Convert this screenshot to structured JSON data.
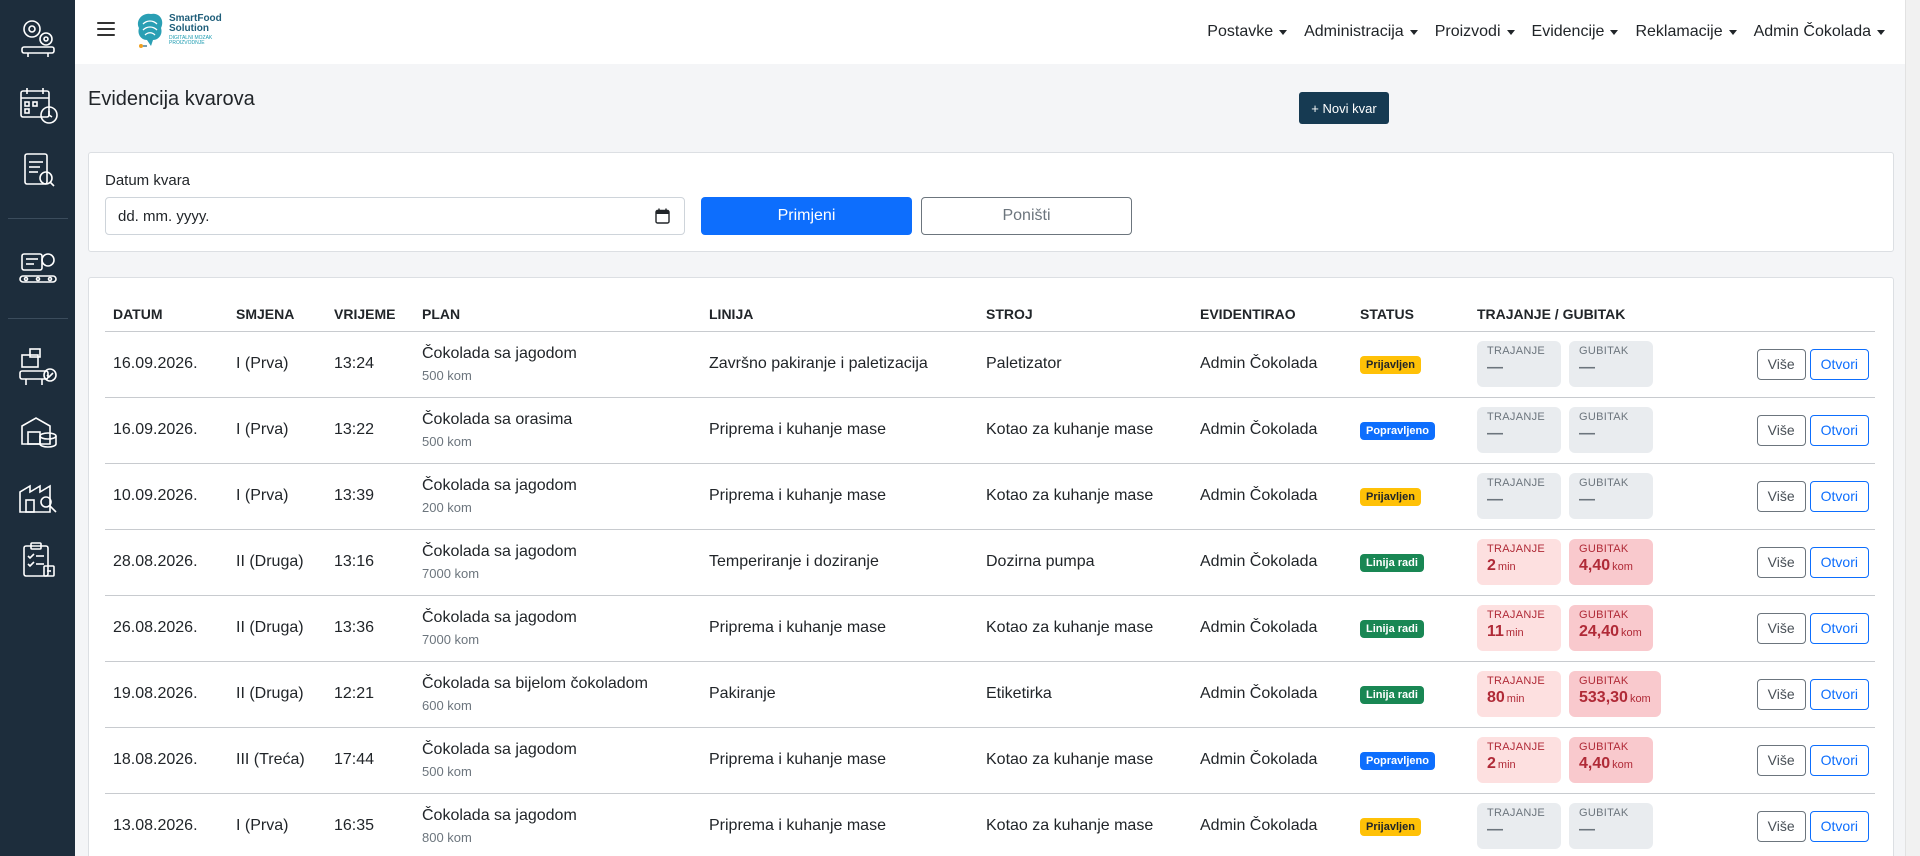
{
  "brand": {
    "name_line1": "SmartFood",
    "name_line2": "Solution",
    "tagline": "DIGITALNI MOZAK PROIZVODNJE"
  },
  "nav": {
    "items": [
      "Postavke",
      "Administracija",
      "Proizvodi",
      "Evidencije",
      "Reklamacije",
      "Admin Čokolada"
    ]
  },
  "sidebar": {
    "icons": [
      "factory-gears-icon",
      "calendar-schedule-icon",
      "report-analytics-icon",
      "production-line-icon",
      "delivery-tracking-icon",
      "warehouse-storage-icon",
      "machine-maintenance-icon",
      "checklist-clipboard-icon"
    ]
  },
  "page": {
    "title": "Evidencija kvarova",
    "new_button": "+ Novi kvar"
  },
  "filter": {
    "label": "Datum kvara",
    "date_placeholder": "dd. mm. yyyy.",
    "apply_label": "Primjeni",
    "reset_label": "Poništi"
  },
  "table": {
    "headers": [
      "Datum",
      "Smjena",
      "Vrijeme",
      "Plan",
      "Linija",
      "Stroj",
      "Evidentirao",
      "Status",
      "Trajanje / Gubitak"
    ],
    "metric_labels": {
      "duration": "TRAJANJE",
      "loss": "GUBITAK"
    },
    "empty_value": "—",
    "action_more": "Više",
    "action_open": "Otvori",
    "rows": [
      {
        "date": "16.09.2026.",
        "shift": "I (Prva)",
        "time": "13:24",
        "plan": "Čokolada sa jagodom",
        "qty": "500 kom",
        "line": "Završno pakiranje i paletizacija",
        "machine": "Paletizator",
        "by": "Admin Čokolada",
        "status": "Prijavljen",
        "status_color": "#ffc107",
        "duration": "—",
        "duration_unit": "",
        "loss": "—",
        "loss_unit": "",
        "tone": "grey"
      },
      {
        "date": "16.09.2026.",
        "shift": "I (Prva)",
        "time": "13:22",
        "plan": "Čokolada sa orasima",
        "qty": "500 kom",
        "line": "Priprema i kuhanje mase",
        "machine": "Kotao za kuhanje mase",
        "by": "Admin Čokolada",
        "status": "Popravljeno",
        "status_color": "#0d6efd",
        "duration": "—",
        "duration_unit": "",
        "loss": "—",
        "loss_unit": "",
        "tone": "grey"
      },
      {
        "date": "10.09.2026.",
        "shift": "I (Prva)",
        "time": "13:39",
        "plan": "Čokolada sa jagodom",
        "qty": "200 kom",
        "line": "Priprema i kuhanje mase",
        "machine": "Kotao za kuhanje mase",
        "by": "Admin Čokolada",
        "status": "Prijavljen",
        "status_color": "#ffc107",
        "duration": "—",
        "duration_unit": "",
        "loss": "—",
        "loss_unit": "",
        "tone": "grey"
      },
      {
        "date": "28.08.2026.",
        "shift": "II (Druga)",
        "time": "13:16",
        "plan": "Čokolada sa jagodom",
        "qty": "7000 kom",
        "line": "Temperiranje i doziranje",
        "machine": "Dozirna pumpa",
        "by": "Admin Čokolada",
        "status": "Linija radi",
        "status_color": "#198754",
        "duration": "2",
        "duration_unit": "min",
        "loss": "4,40",
        "loss_unit": "kom",
        "tone": "red"
      },
      {
        "date": "26.08.2026.",
        "shift": "II (Druga)",
        "time": "13:36",
        "plan": "Čokolada sa jagodom",
        "qty": "7000 kom",
        "line": "Priprema i kuhanje mase",
        "machine": "Kotao za kuhanje mase",
        "by": "Admin Čokolada",
        "status": "Linija radi",
        "status_color": "#198754",
        "duration": "11",
        "duration_unit": "min",
        "loss": "24,40",
        "loss_unit": "kom",
        "tone": "red"
      },
      {
        "date": "19.08.2026.",
        "shift": "II (Druga)",
        "time": "12:21",
        "plan": "Čokolada sa bijelom čokoladom",
        "qty": "600 kom",
        "line": "Pakiranje",
        "machine": "Etiketirka",
        "by": "Admin Čokolada",
        "status": "Linija radi",
        "status_color": "#198754",
        "duration": "80",
        "duration_unit": "min",
        "loss": "533,30",
        "loss_unit": "kom",
        "tone": "red"
      },
      {
        "date": "18.08.2026.",
        "shift": "III (Treća)",
        "time": "17:44",
        "plan": "Čokolada sa jagodom",
        "qty": "500 kom",
        "line": "Priprema i kuhanje mase",
        "machine": "Kotao za kuhanje mase",
        "by": "Admin Čokolada",
        "status": "Popravljeno",
        "status_color": "#0d6efd",
        "duration": "2",
        "duration_unit": "min",
        "loss": "4,40",
        "loss_unit": "kom",
        "tone": "red"
      },
      {
        "date": "13.08.2026.",
        "shift": "I (Prva)",
        "time": "16:35",
        "plan": "Čokolada sa jagodom",
        "qty": "800 kom",
        "line": "Priprema i kuhanje mase",
        "machine": "Kotao za kuhanje mase",
        "by": "Admin Čokolada",
        "status": "Prijavljen",
        "status_color": "#ffc107",
        "duration": "—",
        "duration_unit": "",
        "loss": "—",
        "loss_unit": "",
        "tone": "grey"
      }
    ]
  }
}
